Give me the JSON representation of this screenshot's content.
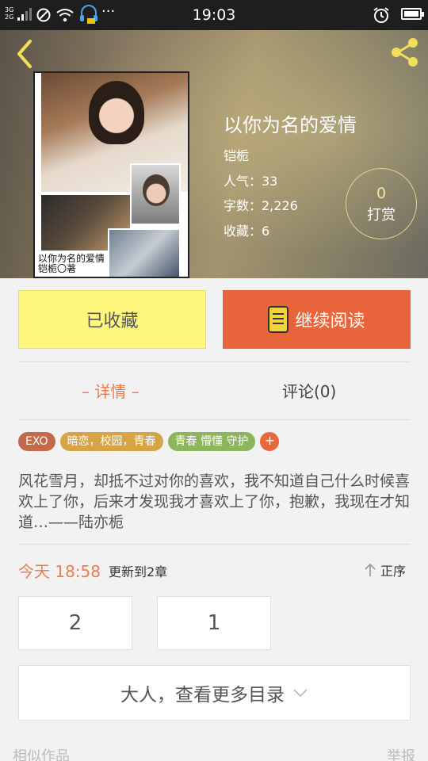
{
  "status_bar": {
    "network_top": "3G",
    "network_bottom": "2G",
    "time": "19:03",
    "more": "···"
  },
  "header": {
    "back_icon": "chevron-left-icon",
    "share_icon": "share-icon"
  },
  "book": {
    "cover_text_line1": "以你为名的爱情",
    "cover_text_line2": "铠栀〇著",
    "title": "以你为名的爱情",
    "author": "铠栀",
    "popularity": "人气：33",
    "word_count": "字数：2,226",
    "favorites": "收藏：6"
  },
  "reward": {
    "count": "0",
    "label": "打赏"
  },
  "actions": {
    "favorited_label": "已收藏",
    "continue_label": "继续阅读"
  },
  "tabs": {
    "details": "– 详情 –",
    "comments": "评论(0)"
  },
  "tags": [
    "EXO",
    "暗恋，校园，青春",
    "青春 懵懂 守护"
  ],
  "tag_add": "+",
  "synopsis": "风花雪月，却抵不过对你的喜欢，我不知道自己什么时候喜欢上了你，后来才发现我才喜欢上了你，抱歉，我现在才知道…——陆亦栀",
  "update": {
    "time": "今天 18:58",
    "text": "更新到2章",
    "sort_label": "正序"
  },
  "chapters": [
    "2",
    "1"
  ],
  "more_catalog": "大人，查看更多目录",
  "footer": {
    "similar": "相似作品",
    "report": "举报"
  },
  "colors": {
    "accent": "#e8643b",
    "favorite_bg": "#fef77e",
    "tab_active": "#ee7c4c"
  }
}
